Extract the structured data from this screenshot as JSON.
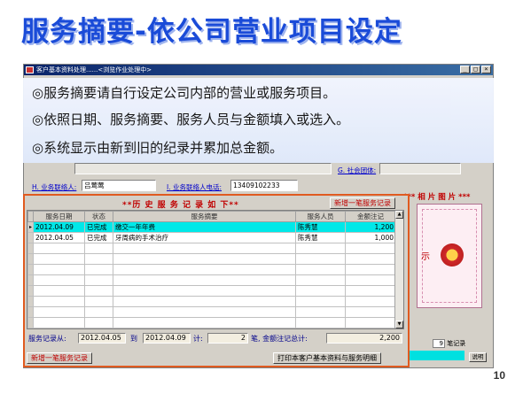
{
  "slide": {
    "title": "服务摘要-依公司营业项目设定",
    "page_number": "10"
  },
  "window": {
    "title": "客户基本资料处理......<浏览作业处理中>",
    "controls": [
      "_",
      "□",
      "×"
    ]
  },
  "callout": {
    "bullets": [
      "◎服务摘要请自行设定公司内部的营业或服务项目。",
      "◎依照日期、服务摘要、服务人员与金额填入或选入。",
      "◎系统显示由新到旧的纪录并累加总金额。"
    ]
  },
  "form": {
    "social_group_label": "G. 社会团体:",
    "contact_label": "H. 业务联络人:",
    "contact_value": "吕莺莺",
    "contact_phone_label": "I. 业务联络人电话:",
    "contact_phone_value": "13409102233"
  },
  "photo": {
    "heading": "*** 相 片 图 片 ***",
    "flower_label": "示"
  },
  "history": {
    "title": "**历 史 服 务 记 录 如 下**",
    "add_top_label": "新增一笔服务记录",
    "columns": [
      "服务日期",
      "状态",
      "服务摘要",
      "服务人员",
      "金额注记"
    ],
    "rows": [
      {
        "date": "2012.04.09",
        "status": "已完成",
        "summary": "缴交一年年费",
        "staff": "陈秀慧",
        "amount": "1,200"
      },
      {
        "date": "2012.04.05",
        "status": "已完成",
        "summary": "牙周病的手术治疗",
        "staff": "陈秀慧",
        "amount": "1,000"
      }
    ],
    "selected_indicator": "▸",
    "summary": {
      "from_label": "服务记录从:",
      "from_value": "2012.04.05",
      "to_label": "到",
      "to_value": "2012.04.09",
      "count_label": "计:",
      "count_value": "2",
      "total_label": "笔, 金额注记总计:",
      "total_value": "2,200"
    },
    "add_bottom_label": "新增一笔服务记录",
    "print_label": "打印本客户基本资料与服务明细"
  },
  "side": {
    "record_count_value": "9",
    "record_count_label": "笔记录",
    "help_label": "说明"
  }
}
